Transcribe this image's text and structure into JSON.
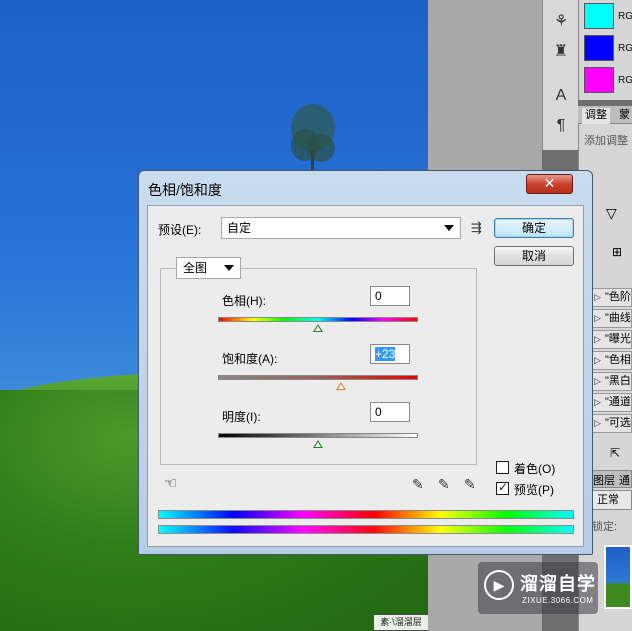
{
  "dialog": {
    "title": "色相/饱和度",
    "close_label": "✕",
    "preset_label": "预设(E):",
    "preset_value": "自定",
    "ok_label": "确定",
    "cancel_label": "取消",
    "edit_value": "全图",
    "hue": {
      "label": "色相(H):",
      "value": "0",
      "level": 0.5
    },
    "saturation": {
      "label": "饱和度(A):",
      "value": "+23",
      "level": 0.615
    },
    "lightness": {
      "label": "明度(I):",
      "value": "0",
      "level": 0.5
    },
    "colorize_label": "着色(O)",
    "colorize_checked": false,
    "preview_label": "预览(P)",
    "preview_checked": true
  },
  "swatches": [
    {
      "color": "#00ffff",
      "label": "RG"
    },
    {
      "color": "#0000ff",
      "label": "RG"
    },
    {
      "color": "#ff00ff",
      "label": "RG"
    }
  ],
  "panel": {
    "tab_adjust": "调整",
    "tab_mask": "蒙",
    "add_adjust": "添加调整",
    "presets": [
      "\"色阶",
      "\"曲线",
      "\"曝光",
      "\"色相",
      "\"黑白",
      "\"通道",
      "\"可选"
    ]
  },
  "layers": {
    "tab": "图层",
    "tab2": "通",
    "mode": "正常",
    "lock": "锁定:"
  },
  "watermark": {
    "name": "溜溜自学",
    "url": "ZIXUE.3066.COM"
  },
  "caption": "素·\\溜溜层"
}
